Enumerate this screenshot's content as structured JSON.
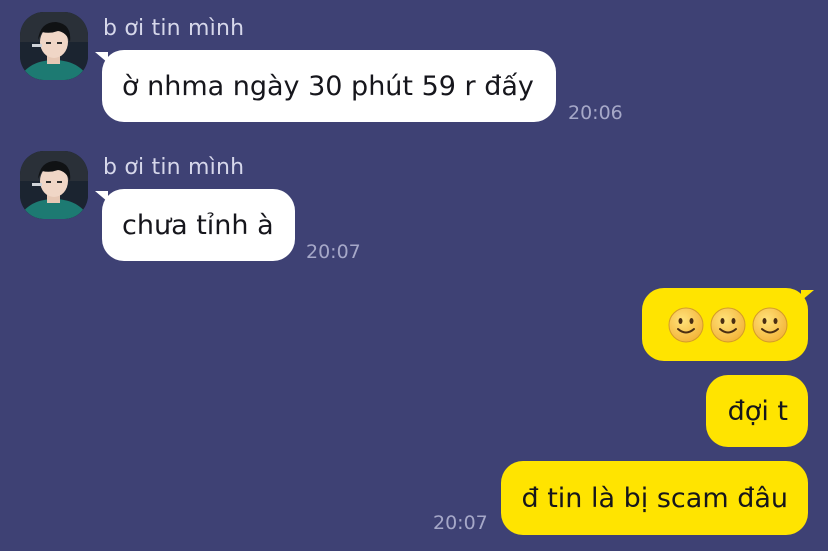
{
  "colors": {
    "background": "#3e4174",
    "incoming_bubble": "#ffffff",
    "outgoing_bubble": "#ffe400",
    "name_text": "#d6d7ea",
    "time_text": "#a6a8c8"
  },
  "messages": [
    {
      "direction": "incoming",
      "sender": "b ơi tin mình",
      "avatar": "avatar-icon",
      "text": "ờ nhma ngày 30 phút 59 r đấy",
      "time": "20:06"
    },
    {
      "direction": "incoming",
      "sender": "b ơi tin mình",
      "avatar": "avatar-icon",
      "text": "chưa tỉnh à",
      "time": "20:07"
    },
    {
      "direction": "outgoing",
      "emoji": [
        "slightly-smiling-face",
        "slightly-smiling-face",
        "slightly-smiling-face"
      ]
    },
    {
      "direction": "outgoing",
      "text": "đợi t"
    },
    {
      "direction": "outgoing",
      "text": "đ tin là bị scam đâu",
      "time": "20:07"
    }
  ]
}
